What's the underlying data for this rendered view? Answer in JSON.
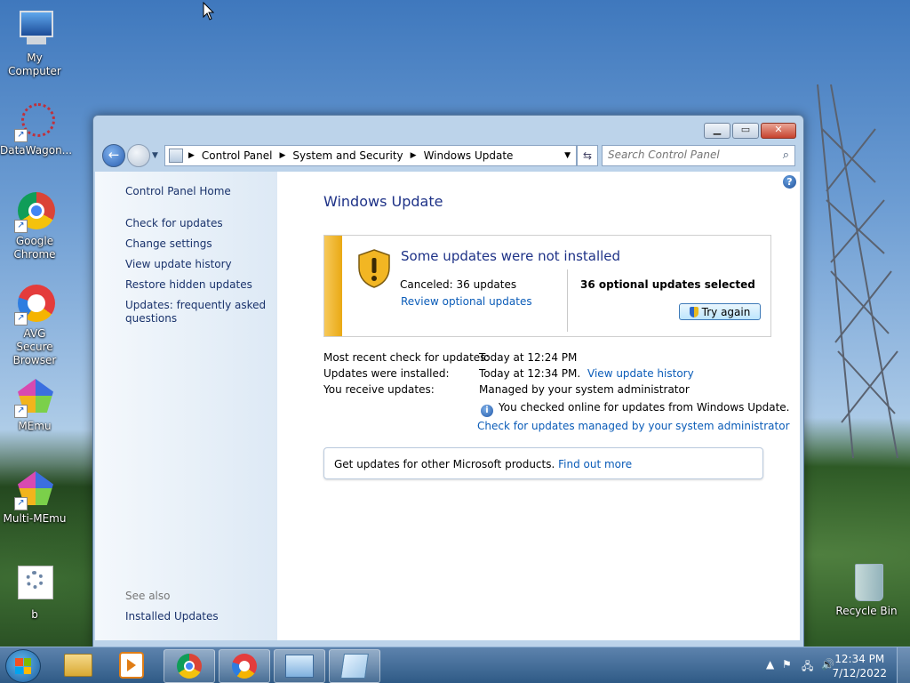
{
  "desktop": {
    "icons": [
      {
        "label": "My Computer"
      },
      {
        "label": "DataWagon..."
      },
      {
        "label": "Google Chrome"
      },
      {
        "label": "AVG Secure Browser"
      },
      {
        "label": "MEmu"
      },
      {
        "label": "Multi-MEmu"
      },
      {
        "label": "b"
      },
      {
        "label": "Recycle Bin"
      }
    ]
  },
  "window": {
    "address": {
      "crumbs": [
        "Control Panel",
        "System and Security",
        "Windows Update"
      ]
    },
    "search": {
      "placeholder": "Search Control Panel"
    },
    "sidebar": {
      "home": "Control Panel Home",
      "links": [
        "Check for updates",
        "Change settings",
        "View update history",
        "Restore hidden updates",
        "Updates: frequently asked",
        "questions"
      ],
      "see_also": "See also",
      "installed_updates": "Installed Updates"
    },
    "main": {
      "title": "Windows Update",
      "status": {
        "heading": "Some updates were not installed",
        "canceled": "Canceled: 36 updates",
        "review_link": "Review optional updates",
        "optional_selected": "36 optional updates selected",
        "try_again": "Try again"
      },
      "info": {
        "recent_label": "Most recent check for updates:",
        "recent_value": "Today at 12:24 PM",
        "installed_label": "Updates were installed:",
        "installed_value": "Today at 12:34 PM.",
        "history_link": "View update history",
        "receive_label": "You receive updates:",
        "receive_value": "Managed by your system administrator",
        "checked_online": "You checked online for updates from Windows Update.",
        "managed_link": "Check for updates managed by your system administrator"
      },
      "other_products": {
        "text": "Get updates for other Microsoft products.",
        "link": "Find out more"
      }
    }
  },
  "taskbar": {
    "clock_time": "12:34 PM",
    "clock_date": "7/12/2022"
  },
  "colors": {
    "title_blue": "#1e3287",
    "link_blue": "#0b5cb8",
    "warning_bar": "#e9a914"
  }
}
